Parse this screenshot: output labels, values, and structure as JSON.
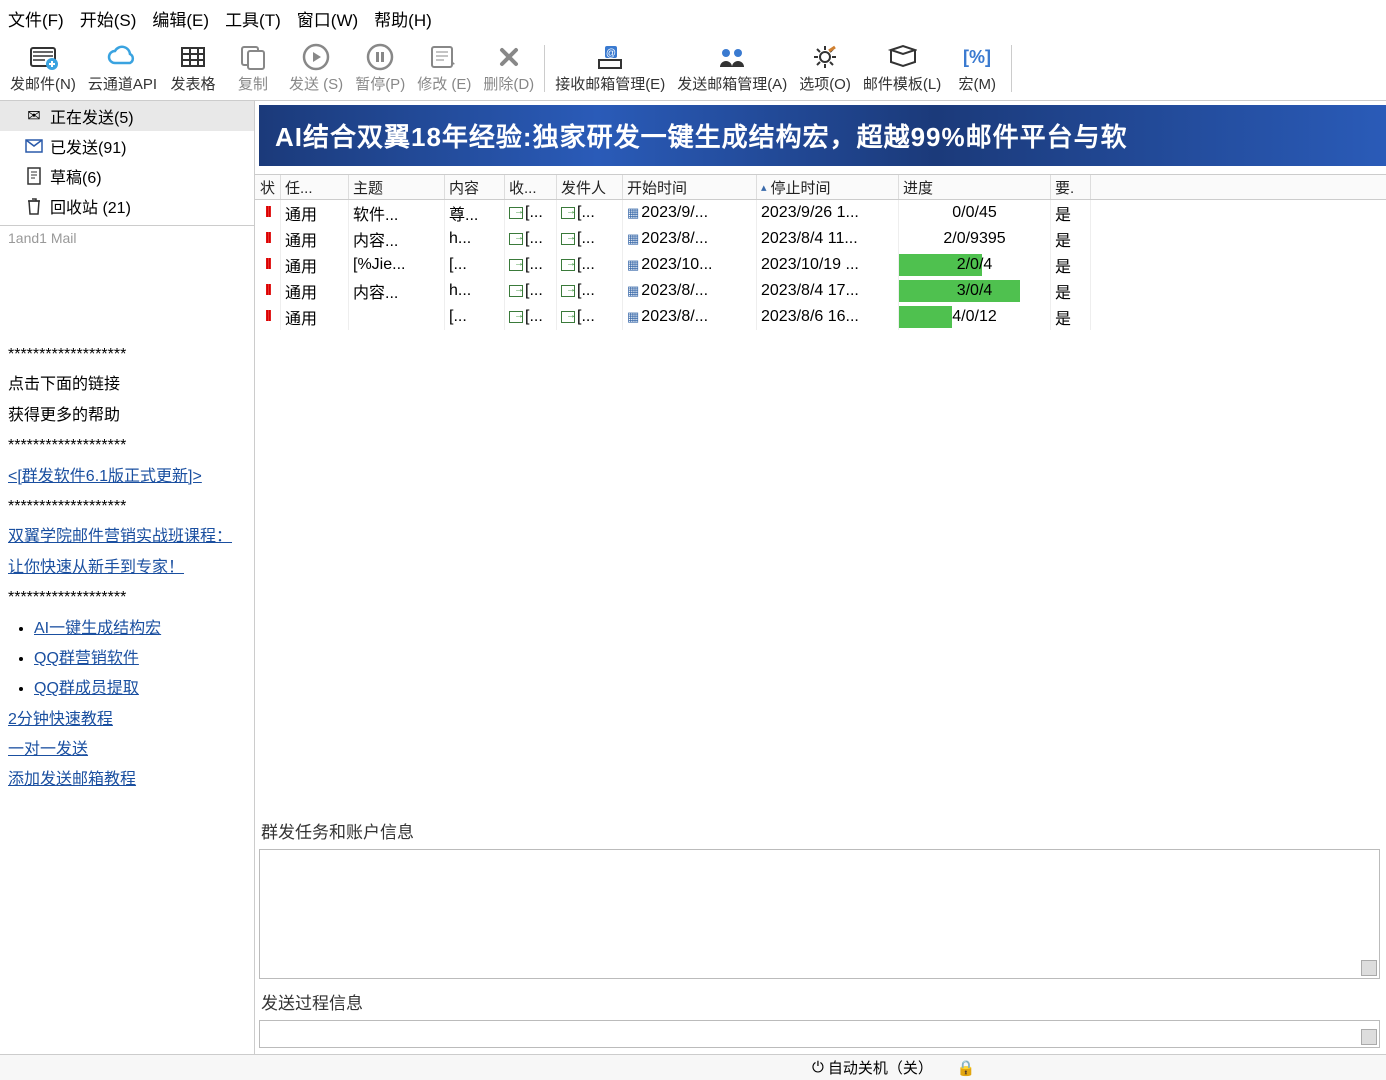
{
  "menu": [
    "文件(F)",
    "开始(S)",
    "编辑(E)",
    "工具(T)",
    "窗口(W)",
    "帮助(H)"
  ],
  "toolbar": [
    {
      "id": "send-mail",
      "label": "发邮件(N)"
    },
    {
      "id": "cloud-api",
      "label": "云通道API"
    },
    {
      "id": "send-table",
      "label": "发表格"
    },
    {
      "id": "copy",
      "label": "复制"
    },
    {
      "id": "send",
      "label": "发送 (S)"
    },
    {
      "id": "pause",
      "label": "暂停(P)"
    },
    {
      "id": "modify",
      "label": "修改 (E)"
    },
    {
      "id": "delete",
      "label": "删除(D)"
    },
    {
      "sep": true
    },
    {
      "id": "recv-acct",
      "label": "接收邮箱管理(E)"
    },
    {
      "id": "send-acct",
      "label": "发送邮箱管理(A)"
    },
    {
      "id": "options",
      "label": "选项(O)"
    },
    {
      "id": "template",
      "label": "邮件模板(L)"
    },
    {
      "id": "macro",
      "label": "宏(M)"
    }
  ],
  "folders": [
    {
      "id": "sending",
      "label": "正在发送(5)",
      "selected": true
    },
    {
      "id": "sent",
      "label": "已发送(91)"
    },
    {
      "id": "draft",
      "label": "草稿(6)"
    },
    {
      "id": "trash",
      "label": "回收站 (21)"
    }
  ],
  "brand": "1and1 Mail",
  "help": {
    "stars": "*******************",
    "line1": "点击下面的链接",
    "line2": "获得更多的帮助",
    "link_update": "<[群发软件6.1版正式更新]>",
    "link_course": "双翼学院邮件营销实战班课程：让你快速从新手到专家！",
    "bullets": [
      "AI一键生成结构宏",
      "QQ群营销软件",
      "QQ群成员提取"
    ],
    "quick": "2分钟快速教程",
    "one": "一对一发送",
    "addsmtp": "添加发送邮箱教程"
  },
  "banner": "AI结合双翼18年经验:独家研发一键生成结构宏，超越99%邮件平台与软",
  "columns": {
    "status": "状",
    "task": "任...",
    "subj": "主题",
    "cont": "内容",
    "recv": "收...",
    "send": "发件人",
    "start": "开始时间",
    "stop": "停止时间",
    "prog": "进度",
    "req": "要."
  },
  "rows": [
    {
      "task": "通用",
      "subj": "软件...",
      "cont": "尊...",
      "recv": "[...",
      "send": "[...",
      "start": "2023/9/...",
      "stop": "2023/9/26 1...",
      "prog": "0/0/45",
      "bar": 0,
      "req": "是"
    },
    {
      "task": "通用",
      "subj": "内容...",
      "cont": "h...",
      "recv": "[...",
      "send": "[...",
      "start": "2023/8/...",
      "stop": "2023/8/4 11...",
      "prog": "2/0/9395",
      "bar": 0,
      "req": "是"
    },
    {
      "task": "通用",
      "subj": "[%Jie...",
      "cont": "[...",
      "recv": "[...",
      "send": "[...",
      "start": "2023/10...",
      "stop": "2023/10/19 ...",
      "prog": "2/0/4",
      "bar": 55,
      "req": "是"
    },
    {
      "task": "通用",
      "subj": "内容...",
      "cont": "h...",
      "recv": "[...",
      "send": "[...",
      "start": "2023/8/...",
      "stop": "2023/8/4 17...",
      "prog": "3/0/4",
      "bar": 80,
      "req": "是"
    },
    {
      "task": "通用",
      "subj": "",
      "cont": "[...",
      "recv": "[...",
      "send": "[...",
      "start": "2023/8/...",
      "stop": "2023/8/6 16...",
      "prog": "4/0/12",
      "bar": 35,
      "req": "是"
    }
  ],
  "section1": "群发任务和账户信息",
  "section2": "发送过程信息",
  "status": {
    "auto": "自动关机（关）"
  }
}
